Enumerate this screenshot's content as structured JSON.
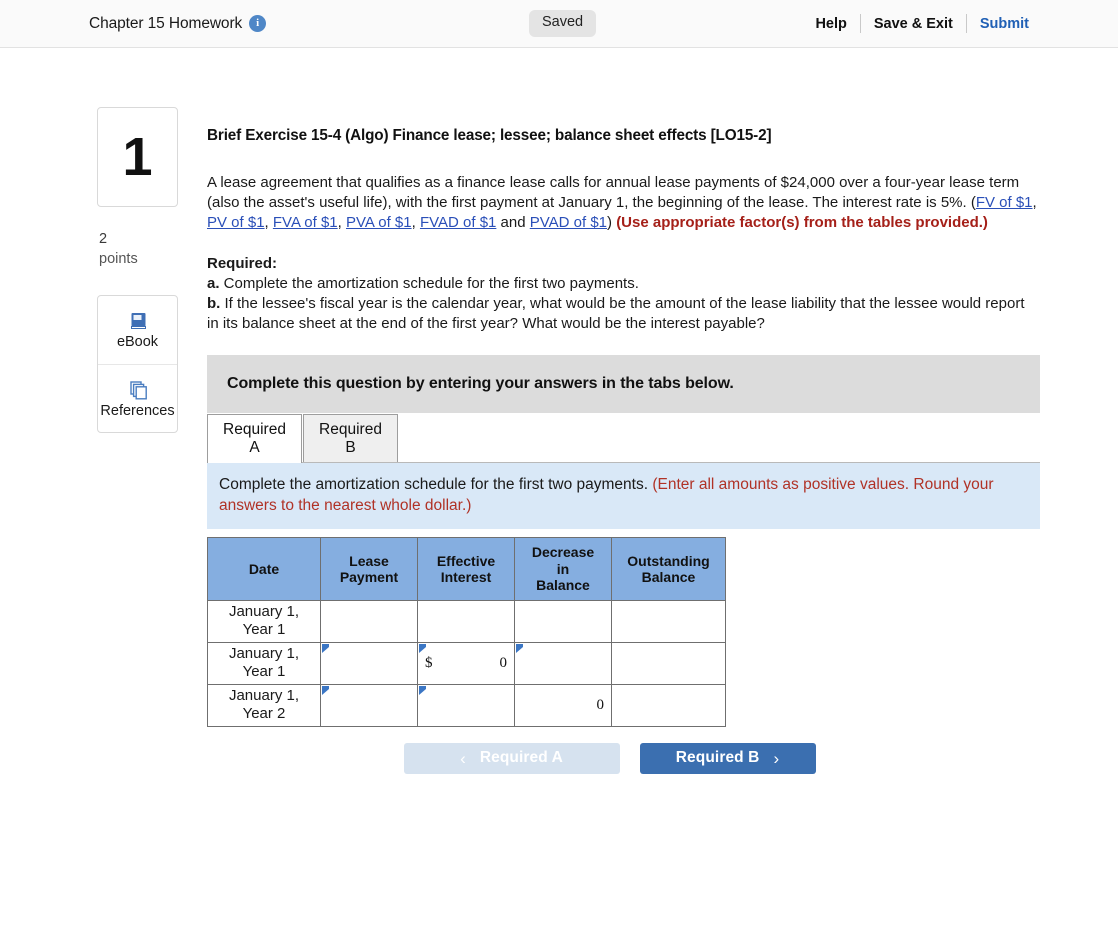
{
  "topbar": {
    "homework_title": "Chapter 15 Homework",
    "info_icon": "info-icon",
    "status_badge": "Saved",
    "help_label": "Help",
    "save_exit_label": "Save & Exit",
    "submit_label": "Submit"
  },
  "rail": {
    "question_number": "1",
    "points_value": "2",
    "points_label": "points",
    "ebook_label": "eBook",
    "references_label": "References"
  },
  "exercise": {
    "title": "Brief Exercise 15-4 (Algo) Finance lease; lessee; balance sheet effects [LO15-2]",
    "para_1": "A lease agreement that qualifies as a finance lease calls for annual lease payments of $24,000 over a four-year lease term (also the asset's useful life), with the first payment at January 1, the beginning of the lease. The interest rate is 5%. (",
    "links": [
      "FV of $1",
      "PV of $1",
      "FVA of $1",
      "PVA of $1",
      "FVAD of $1",
      "PVAD of $1"
    ],
    "link_sep": ", ",
    "link_and": " and ",
    "para_1_close": ") ",
    "red_note": "(Use appropriate factor(s) from the tables provided.)",
    "required_heading": "Required:",
    "req_a_marker": "a.",
    "req_a_text": " Complete the amortization schedule for the first two payments.",
    "req_b_marker": "b.",
    "req_b_text": " If the lessee's fiscal year is the calendar year, what would be the amount of the lease liability that the lessee would report in its balance sheet at the end of the first year? What would be the interest payable?"
  },
  "banner": {
    "text": "Complete this question by entering your answers in the tabs below."
  },
  "tabs": [
    {
      "line1": "Required",
      "line2": "A",
      "active": true
    },
    {
      "line1": "Required",
      "line2": "B",
      "active": false
    }
  ],
  "instruction": {
    "main": "Complete the amortization schedule for the first two payments. ",
    "note": "(Enter all amounts as positive values. Round your answers to the nearest whole dollar.)"
  },
  "table": {
    "headers": [
      "Date",
      "Lease\nPayment",
      "Effective\nInterest",
      "Decrease\nin\nBalance",
      "Outstanding\nBalance"
    ],
    "headers_display": {
      "date": "Date",
      "lease_payment": [
        "Lease",
        "Payment"
      ],
      "effective_interest": [
        "Effective",
        "Interest"
      ],
      "decrease_in_balance": [
        "Decrease",
        "in",
        "Balance"
      ],
      "outstanding_balance": [
        "Outstanding",
        "Balance"
      ]
    },
    "rows": [
      {
        "date": [
          "January 1,",
          "Year 1"
        ],
        "lease_payment": "",
        "effective_interest": "",
        "decrease_in_balance": "",
        "outstanding_balance": ""
      },
      {
        "date": [
          "January 1,",
          "Year 1"
        ],
        "lease_payment": "",
        "effective_interest": "0",
        "effective_interest_prefix": "$",
        "decrease_in_balance": "",
        "outstanding_balance": ""
      },
      {
        "date": [
          "January 1,",
          "Year 2"
        ],
        "lease_payment": "",
        "effective_interest": "",
        "decrease_in_balance": "0",
        "outstanding_balance": ""
      }
    ]
  },
  "nav": {
    "prev_label": "Required A",
    "prev_chevron": "‹",
    "next_label": "Required B",
    "next_chevron": "›"
  },
  "colors": {
    "table_header_blue": "#85aee0",
    "instruction_blue": "#d9e8f7",
    "banner_grey": "#dcdcdc",
    "next_button_blue": "#3b6fb0",
    "prev_button_blue": "#d6e2ef",
    "link_blue": "#2a4fb8",
    "red_note": "#a52019",
    "submit_blue": "#2060b5",
    "selected_cell_border": "#3b76c4"
  }
}
